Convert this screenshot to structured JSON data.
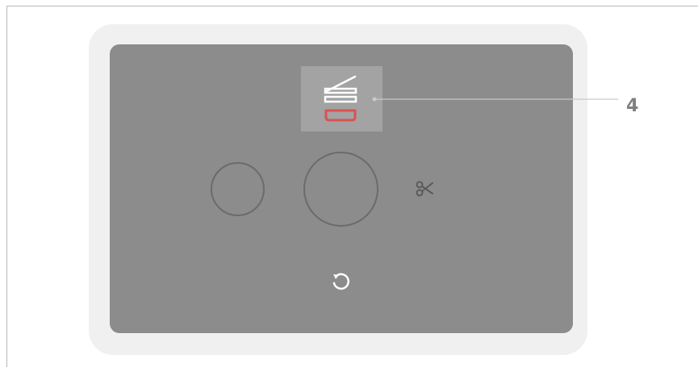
{
  "callout": {
    "number": "4"
  },
  "colors": {
    "screen": "#8c8c8c",
    "bezel": "#f0f0f0",
    "mode_tile": "#a3a3a3",
    "tray_highlight": "#d9534f",
    "icon_white": "#ffffff",
    "icon_dark": "#6b6b6b",
    "callout_text": "#808080"
  },
  "icons": {
    "mode_tile": "paper-tray-icon",
    "side_button": "scissors-icon",
    "bottom_button": "reset-icon"
  }
}
